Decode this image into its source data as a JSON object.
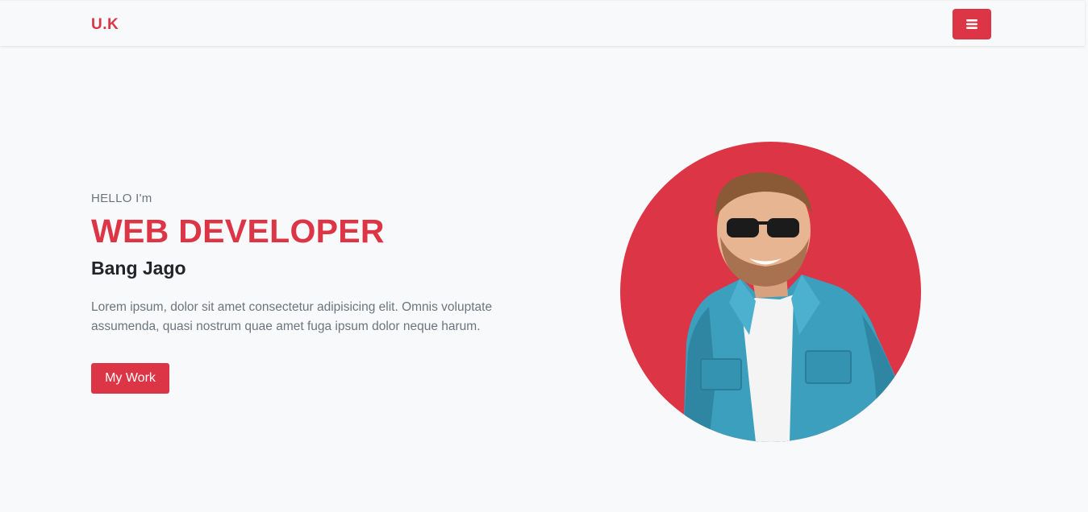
{
  "navbar": {
    "brand": "U.K",
    "toggle_icon": "hamburger-menu-icon",
    "accent_color": "#dc3545"
  },
  "hero": {
    "greeting": "HELLO I'm",
    "role": "WEB DEVELOPER",
    "name": "Bang Jago",
    "description": "Lorem ipsum, dolor sit amet consectetur adipisicing elit. Omnis voluptate assumenda, quasi nostrum quae amet fuga ipsum dolor neque harum.",
    "cta_label": "My Work"
  },
  "profile_image": {
    "background_color": "#dc3545"
  }
}
